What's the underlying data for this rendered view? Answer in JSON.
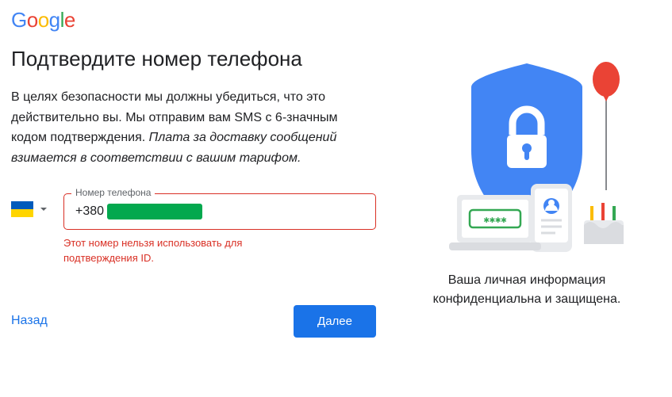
{
  "logo": {
    "g1": "G",
    "o1": "o",
    "o2": "o",
    "g2": "g",
    "l": "l",
    "e": "e"
  },
  "headline": "Подтвердите номер телефона",
  "desc_plain": "В целях безопасности мы должны убедиться, что это действительно вы. Мы отправим вам SMS с 6-значным кодом подтверждения. ",
  "desc_italic": "Плата за доставку сообщений взимается в соответствии с вашим тарифом.",
  "field_label": "Номер телефона",
  "phone_value": "+380",
  "error_text": "Этот номер нельзя использовать для подтверждения ID.",
  "country_selected": "Ukraine",
  "back_label": "Назад",
  "next_label": "Далее",
  "caption": "Ваша личная информация конфиденциальна и защищена."
}
